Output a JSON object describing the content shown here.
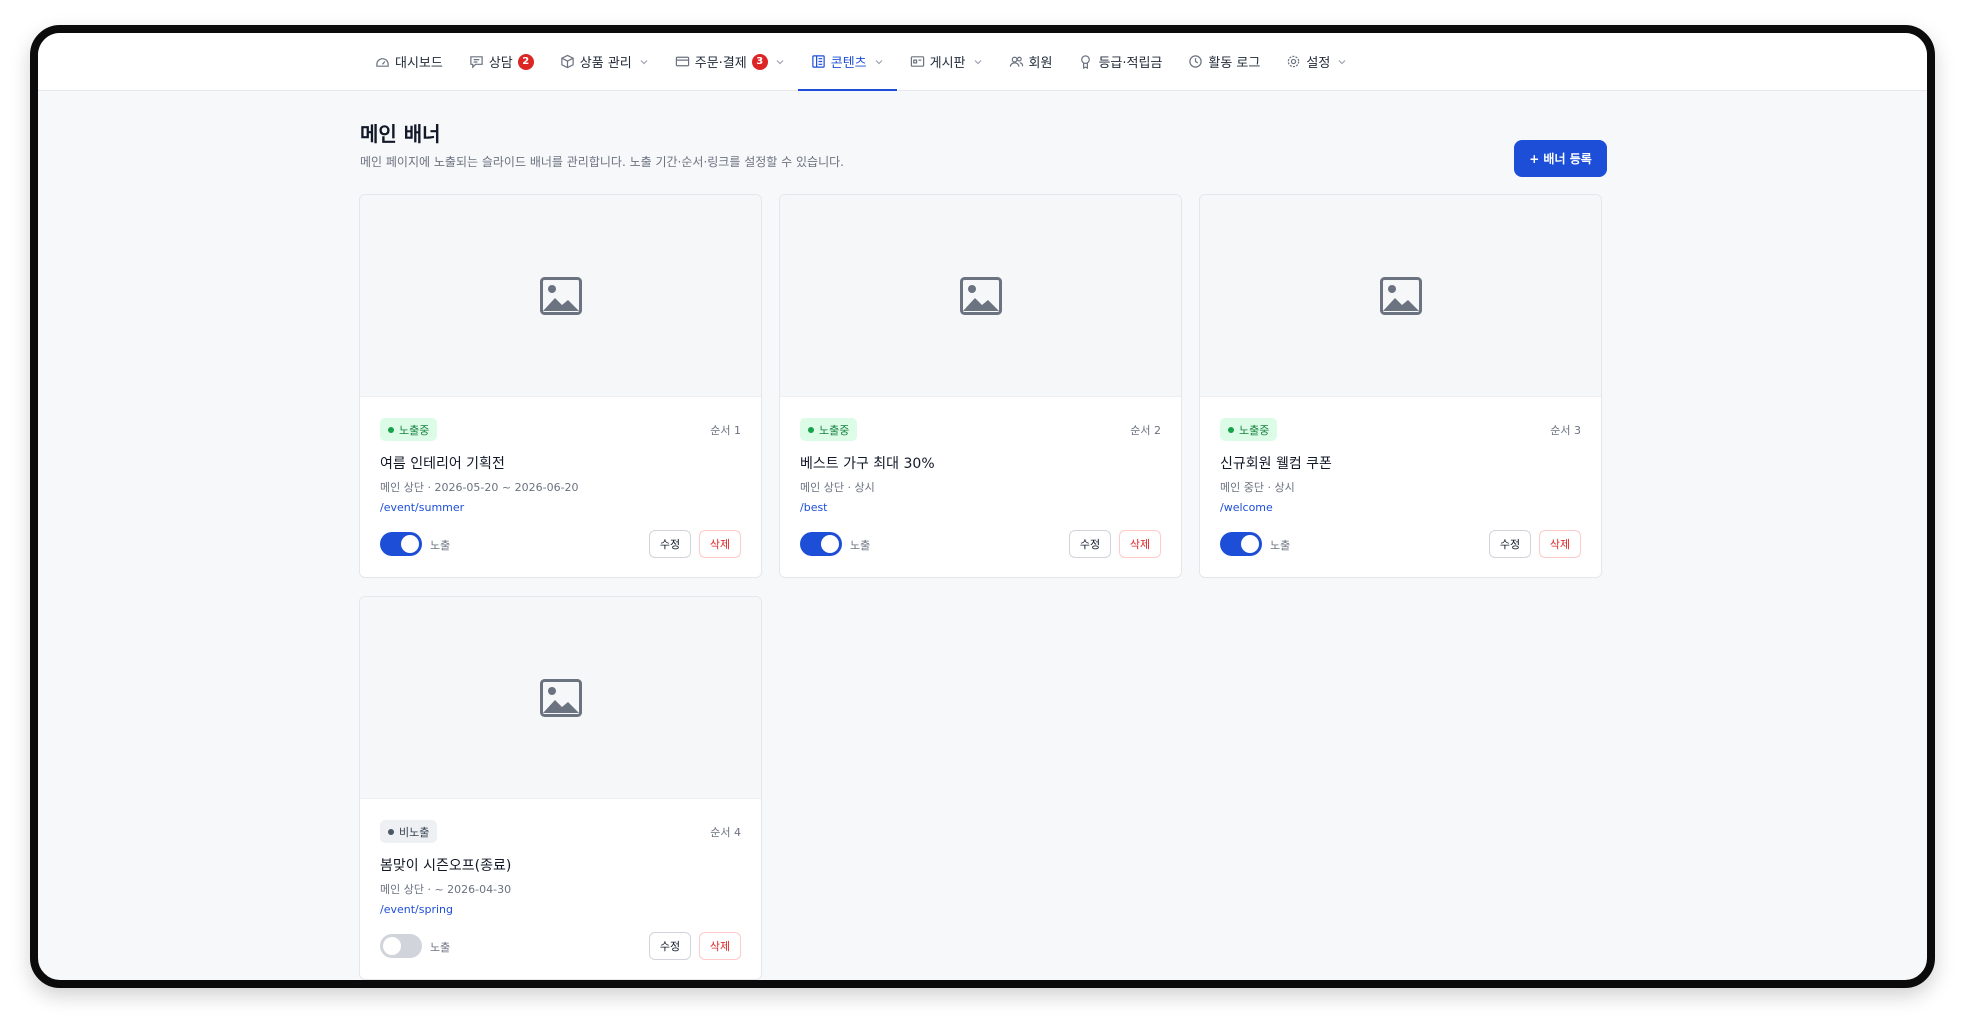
{
  "nav": {
    "items": [
      {
        "label": "대시보드",
        "icon": "dashboard-icon",
        "badge": "",
        "dropdown": false,
        "active": false
      },
      {
        "label": "상담",
        "icon": "chat-icon",
        "badge": "2",
        "dropdown": false,
        "active": false
      },
      {
        "label": "상품 관리",
        "icon": "box-icon",
        "badge": "",
        "dropdown": true,
        "active": false
      },
      {
        "label": "주문·결제",
        "icon": "card-icon",
        "badge": "3",
        "dropdown": true,
        "active": false
      },
      {
        "label": "콘텐츠",
        "icon": "content-icon",
        "badge": "",
        "dropdown": true,
        "active": true
      },
      {
        "label": "게시판",
        "icon": "board-icon",
        "badge": "",
        "dropdown": true,
        "active": false
      },
      {
        "label": "회원",
        "icon": "users-icon",
        "badge": "",
        "dropdown": false,
        "active": false
      },
      {
        "label": "등급·적립금",
        "icon": "medal-icon",
        "badge": "",
        "dropdown": false,
        "active": false
      },
      {
        "label": "활동 로그",
        "icon": "clock-icon",
        "badge": "",
        "dropdown": false,
        "active": false
      },
      {
        "label": "설정",
        "icon": "gear-icon",
        "badge": "",
        "dropdown": true,
        "active": false
      }
    ]
  },
  "page": {
    "title": "메인 배너",
    "description": "메인 페이지에 노출되는 슬라이드 배너를 관리합니다. 노출 기간·순서·링크를 설정할 수 있습니다.",
    "add_button": "+ 배너 등록"
  },
  "banners": [
    {
      "status": "노출중",
      "status_on": true,
      "order": "순서 1",
      "title": "여름 인테리어 기획전",
      "meta": "메인 상단 · 2026-05-20 ~ 2026-06-20",
      "link": "/event/summer",
      "toggle_on": true,
      "toggle_label": "노출",
      "edit": "수정",
      "delete": "삭제"
    },
    {
      "status": "노출중",
      "status_on": true,
      "order": "순서 2",
      "title": "베스트 가구 최대 30%",
      "meta": "메인 상단 · 상시",
      "link": "/best",
      "toggle_on": true,
      "toggle_label": "노출",
      "edit": "수정",
      "delete": "삭제"
    },
    {
      "status": "노출중",
      "status_on": true,
      "order": "순서 3",
      "title": "신규회원 웰컴 쿠폰",
      "meta": "메인 중단 · 상시",
      "link": "/welcome",
      "toggle_on": true,
      "toggle_label": "노출",
      "edit": "수정",
      "delete": "삭제"
    },
    {
      "status": "비노출",
      "status_on": false,
      "order": "순서 4",
      "title": "봄맞이 시즌오프(종료)",
      "meta": "메인 상단 · ~ 2026-04-30",
      "link": "/event/spring",
      "toggle_on": false,
      "toggle_label": "노출",
      "edit": "수정",
      "delete": "삭제"
    }
  ],
  "colors": {
    "accent": "#1d4ed8",
    "danger": "#dc2626",
    "success": "#15803d"
  }
}
